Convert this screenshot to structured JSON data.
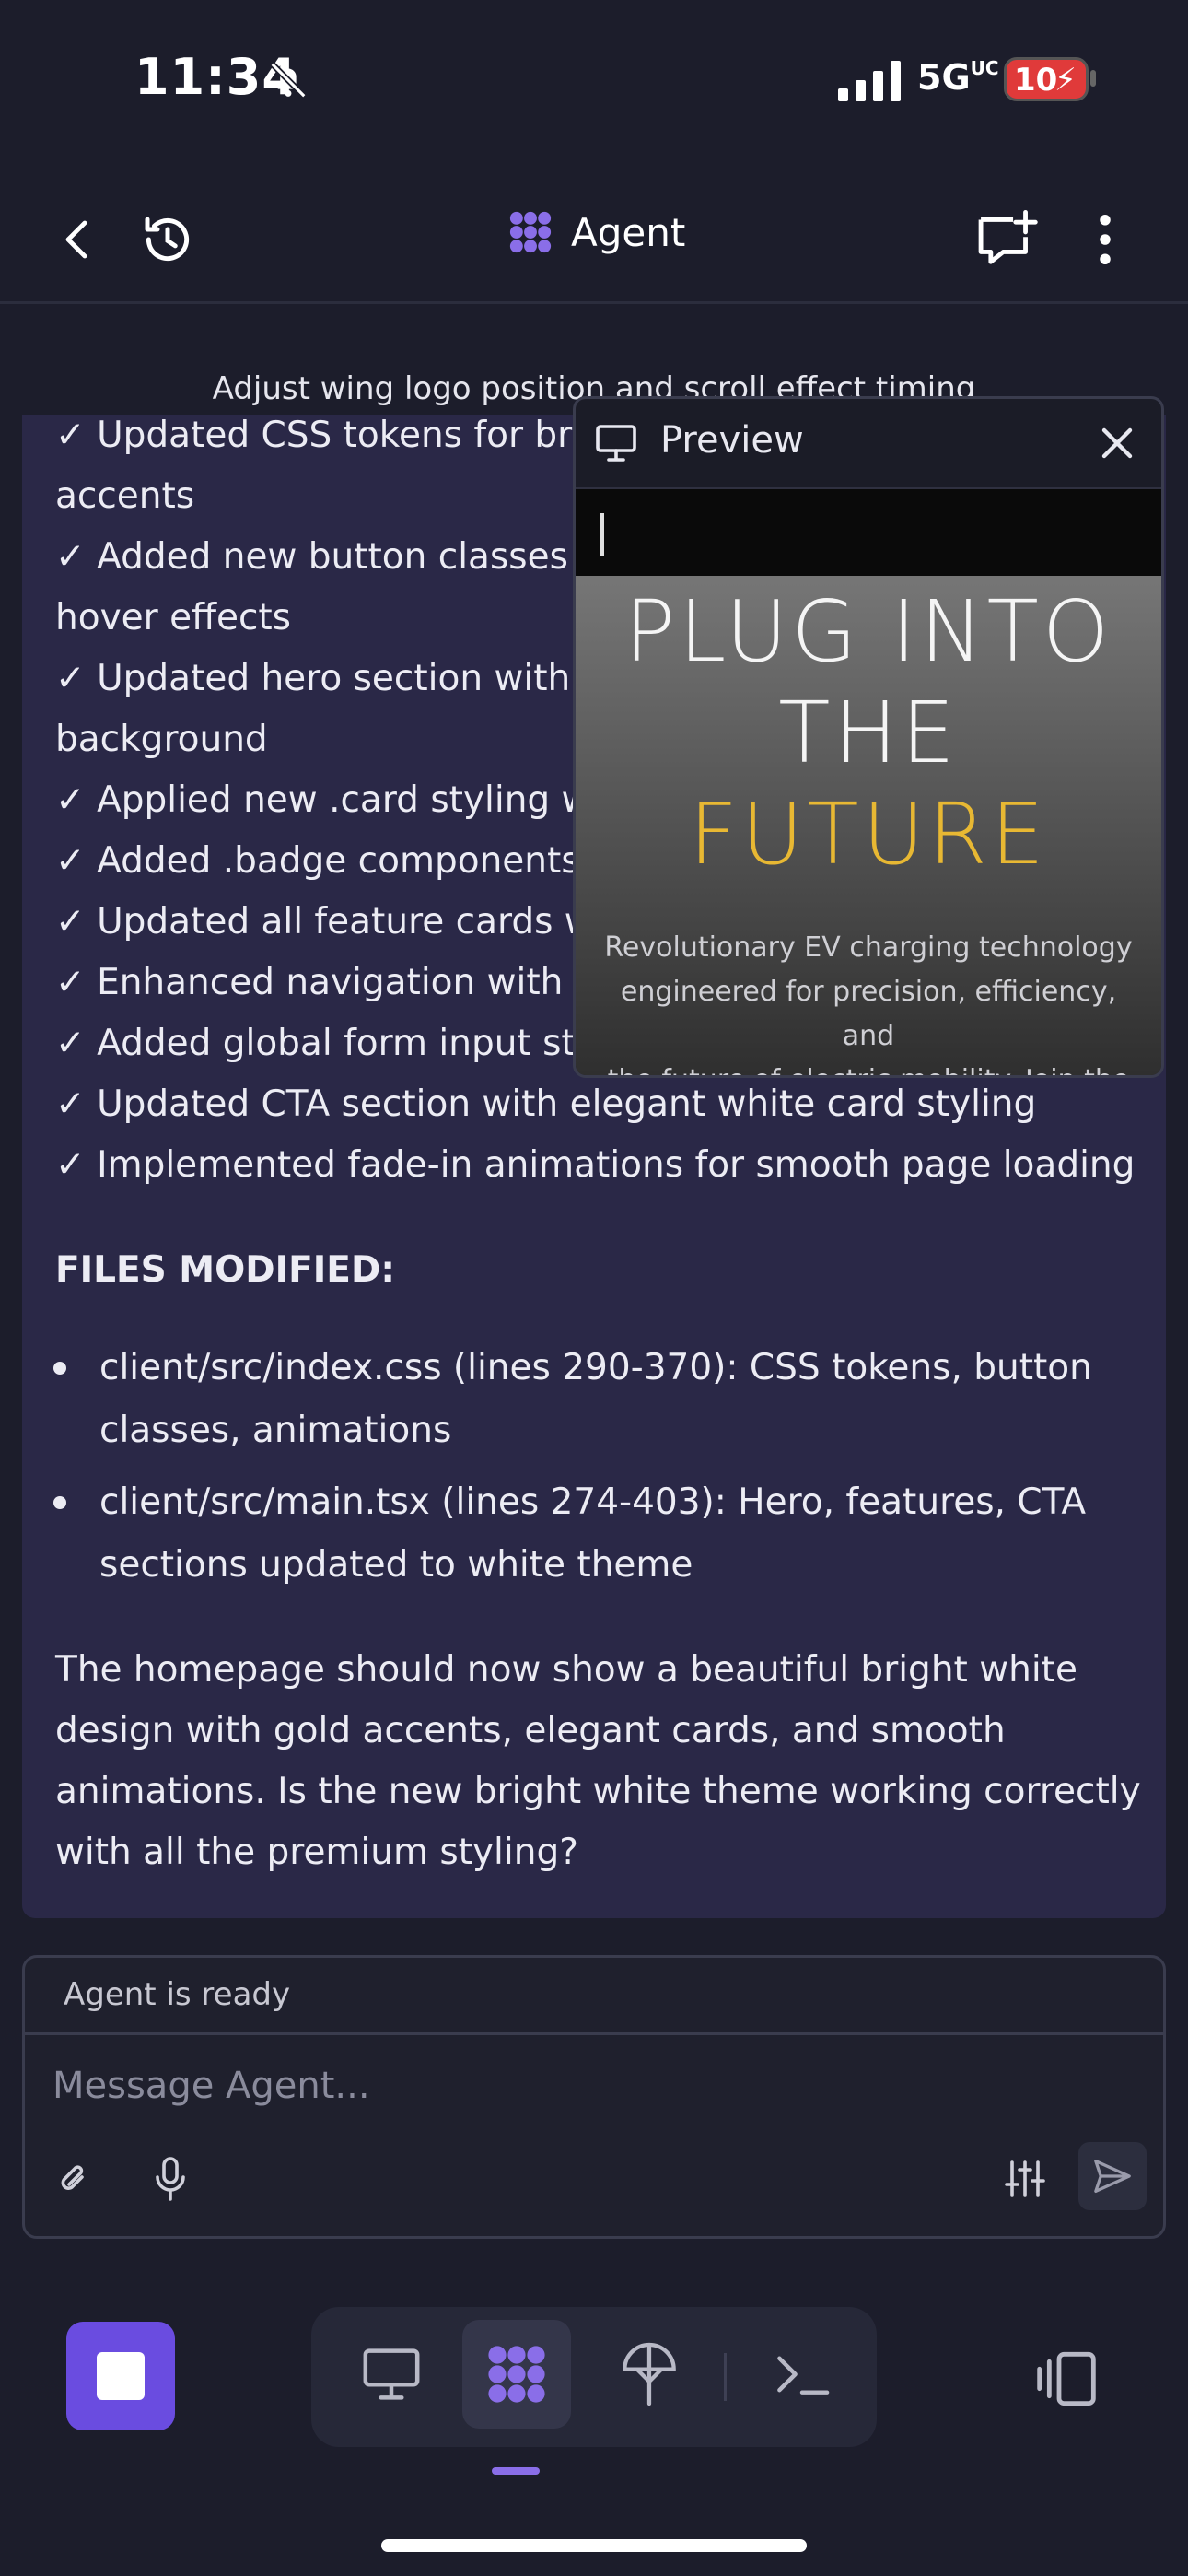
{
  "status_bar": {
    "time": "11:34",
    "network": "5G",
    "network_sup": "UC",
    "battery": "10"
  },
  "header": {
    "title": "Agent"
  },
  "task": {
    "title": "Adjust wing logo position and scroll effect timing"
  },
  "message": {
    "lines": [
      "✓ Updated CSS tokens for brig",
      "accents",
      "✓ Added new button classes (",
      "hover effects",
      "✓ Updated hero section with c",
      "background",
      "✓ Applied new .card styling wi",
      "✓ Added .badge components w",
      "✓ Updated all feature cards w",
      "✓ Enhanced navigation with g",
      "✓ Added global form input sty",
      "✓ Updated CTA section with elegant white card styling",
      "✓ Implemented fade-in animations for smooth page loading"
    ],
    "files_heading": "FILES MODIFIED:",
    "files": [
      {
        "line1": "client/src/index.css (lines 290-370): CSS tokens, button",
        "line2": "classes, animations"
      },
      {
        "line1": "client/src/main.tsx (lines 274-403): Hero, features, CTA",
        "line2": "sections updated to white theme"
      }
    ],
    "closing": [
      "The homepage should now show a beautiful bright white",
      "design with gold accents, elegant cards, and smooth",
      "animations. Is the new bright white theme working correctly",
      "with all the premium styling?"
    ]
  },
  "preview": {
    "title": "Preview",
    "hero_line1": "PLUG INTO",
    "hero_line2": "THE",
    "hero_line3": "FUTURE",
    "subtitle": [
      "Revolutionary EV charging technology",
      "engineered for precision, efficiency, and",
      "the future of electric mobility. Join the"
    ],
    "accent_color": "#e8b833"
  },
  "composer": {
    "status": "Agent is ready",
    "placeholder": "Message Agent..."
  },
  "colors": {
    "brand": "#6a4ce0",
    "agent_icon": "#8a6ee8"
  }
}
